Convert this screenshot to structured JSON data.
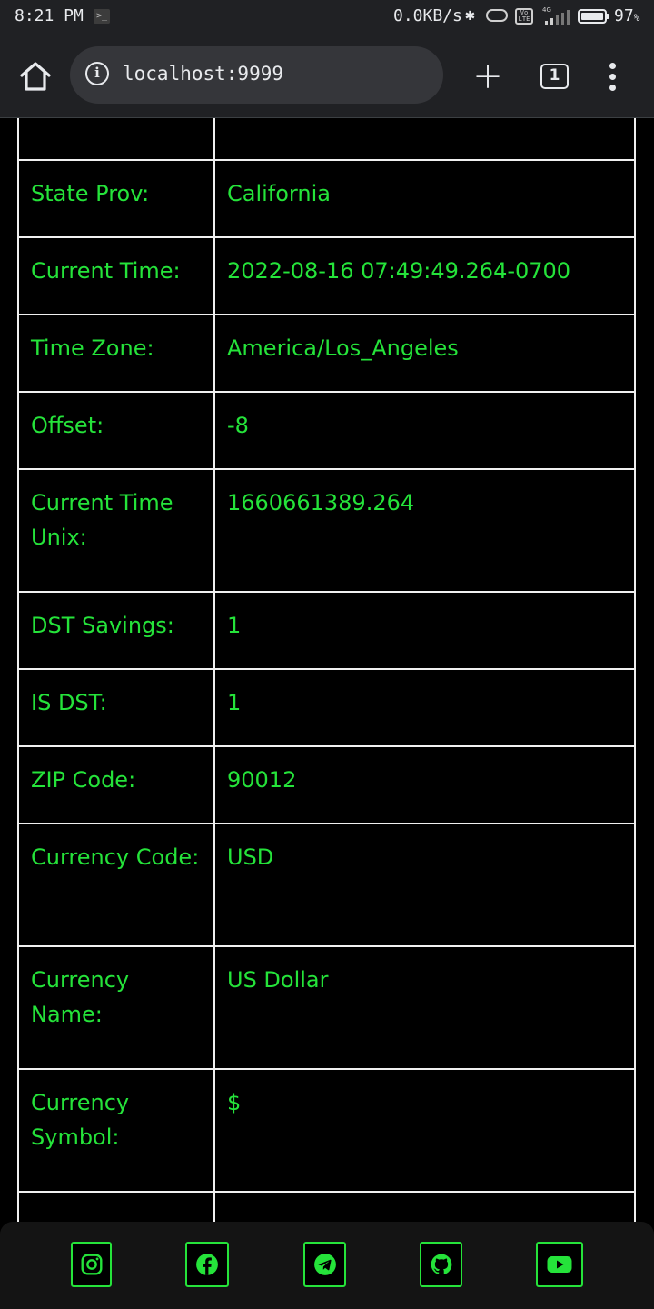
{
  "status_bar": {
    "time": "8:21 PM",
    "net_speed": "0.0KB/s",
    "battery": "97",
    "battery_unit": "%",
    "volte_label": "Vo LTE",
    "signal_label": "4G"
  },
  "browser": {
    "url": "localhost:9999",
    "tab_count": "1"
  },
  "rows": [
    {
      "label": "",
      "value": ""
    },
    {
      "label": "State Prov:",
      "value": "California"
    },
    {
      "label": "Current Time:",
      "value": "2022-08-16 07:49:49.264-0700"
    },
    {
      "label": "Time Zone:",
      "value": "America/Los_Angeles"
    },
    {
      "label": "Offset:",
      "value": "-8"
    },
    {
      "label": "Current Time Unix:",
      "value": "1660661389.264"
    },
    {
      "label": "DST Savings:",
      "value": "1"
    },
    {
      "label": "IS DST:",
      "value": "1"
    },
    {
      "label": "ZIP Code:",
      "value": "90012"
    },
    {
      "label": "Currency Code:",
      "value": "USD"
    },
    {
      "label": "Currency Name:",
      "value": "US Dollar"
    },
    {
      "label": "Currency Symbol:",
      "value": "$"
    },
    {
      "label": "-------------",
      "value": "-------------"
    }
  ],
  "footer": {
    "links": [
      "instagram-icon",
      "facebook-icon",
      "telegram-icon",
      "github-icon",
      "youtube-icon"
    ]
  },
  "colors": {
    "accent": "#25e33a",
    "background": "#000000",
    "browser_chrome": "#202124"
  }
}
